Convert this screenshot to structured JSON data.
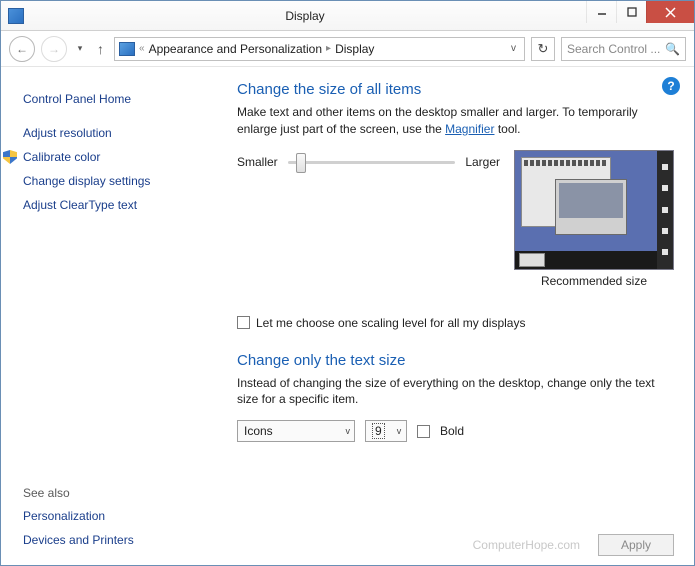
{
  "window": {
    "title": "Display"
  },
  "nav": {
    "breadcrumb": {
      "root_icon": "monitor",
      "crumb1": "Appearance and Personalization",
      "crumb2": "Display"
    },
    "search_placeholder": "Search Control ..."
  },
  "sidebar": {
    "home": "Control Panel Home",
    "links": {
      "adjust_resolution": "Adjust resolution",
      "calibrate_color": "Calibrate color",
      "change_display_settings": "Change display settings",
      "adjust_cleartype": "Adjust ClearType text"
    },
    "see_also_label": "See also",
    "see_also": {
      "personalization": "Personalization",
      "devices_printers": "Devices and Printers"
    }
  },
  "main": {
    "heading1": "Change the size of all items",
    "desc1a": "Make text and other items on the desktop smaller and larger. To temporarily enlarge just part of the screen, use the ",
    "magnifier_link": "Magnifier",
    "desc1b": " tool.",
    "slider": {
      "small": "Smaller",
      "large": "Larger"
    },
    "recommended": "Recommended size",
    "checkbox_label": "Let me choose one scaling level for all my displays",
    "heading2": "Change only the text size",
    "desc2": "Instead of changing the size of everything on the desktop, change only the text size for a specific item.",
    "item_select": "Icons",
    "size_select": "9",
    "bold_label": "Bold",
    "apply": "Apply",
    "watermark": "ComputerHope.com"
  }
}
